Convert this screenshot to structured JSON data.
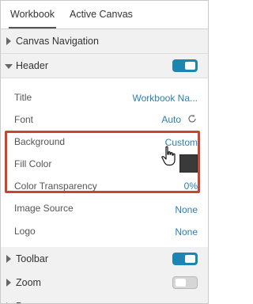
{
  "tabs": {
    "workbook": "Workbook",
    "active_canvas": "Active Canvas"
  },
  "sections": {
    "canvas_navigation": "Canvas Navigation",
    "header": "Header",
    "toolbar": "Toolbar",
    "zoom": "Zoom",
    "partial_label": "D"
  },
  "toggles": {
    "header": "on",
    "toolbar": "on",
    "zoom": "off"
  },
  "properties": {
    "title": {
      "label": "Title",
      "value": "Workbook Na..."
    },
    "font": {
      "label": "Font",
      "value": "Auto"
    },
    "background": {
      "label": "Background",
      "value": "Custom"
    },
    "fill_color": {
      "label": "Fill Color"
    },
    "color_transparency": {
      "label": "Color Transparency",
      "value": "0%"
    },
    "image_source": {
      "label": "Image Source",
      "value": "None"
    },
    "logo": {
      "label": "Logo",
      "value": "None"
    }
  },
  "colors": {
    "accent": "#1e85b1",
    "link": "#2b7fb3",
    "highlight_border": "#c54631",
    "fill_swatch": "#3a3a3a"
  }
}
